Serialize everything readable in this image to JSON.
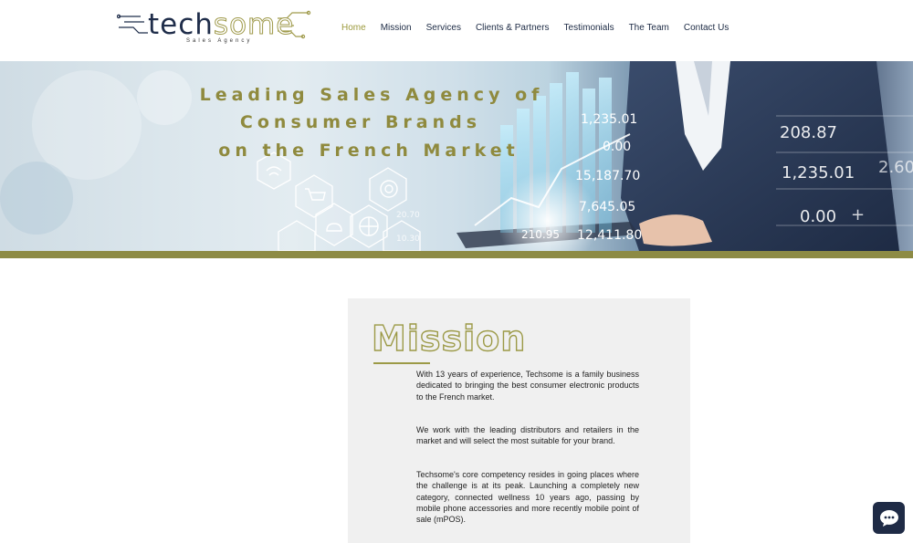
{
  "header": {
    "logo": {
      "word_part1": "tech",
      "word_part2": "some",
      "tagline": "Sales Agency"
    },
    "nav": [
      {
        "label": "Home",
        "active": true
      },
      {
        "label": "Mission",
        "active": false
      },
      {
        "label": "Services",
        "active": false
      },
      {
        "label": "Clients & Partners",
        "active": false
      },
      {
        "label": "Testimonials",
        "active": false
      },
      {
        "label": "The Team",
        "active": false
      },
      {
        "label": "Contact Us",
        "active": false
      }
    ]
  },
  "hero": {
    "lines": [
      "Leading Sales Agency of",
      "Consumer Brands",
      "on the French Market"
    ],
    "image_numbers": [
      "1,235.01",
      "0.00",
      "15,187.70",
      "7,645.05",
      "12,411.80",
      "210.95",
      "208.87",
      "1,235.01",
      "2.60",
      "0.00",
      "+",
      "20.70",
      "10.30"
    ],
    "icons": [
      "wifi-icon",
      "cart-icon",
      "target-icon",
      "cloud-icon",
      "globe-icon"
    ]
  },
  "mission": {
    "title": "Mission",
    "paragraphs": [
      "With 13 years of experience, Techsome is a family business dedicated to bringing the best consumer electronic products to the French market.",
      "We work with the leading distributors and retailers in the market and will select the most suitable for your brand.",
      "Techsome's core competency resides in going places where the challenge is at its peak. Launching a completely new category, connected wellness 10 years ago, passing by mobile phone accessories and more recently mobile point of sale (mPOS)."
    ]
  },
  "chat": {
    "icon": "chat-icon"
  },
  "colors": {
    "accent_olive": "#9c9a47",
    "navy": "#1f2b46",
    "band": "#8d8b45",
    "card_bg": "#f0f0f0"
  }
}
